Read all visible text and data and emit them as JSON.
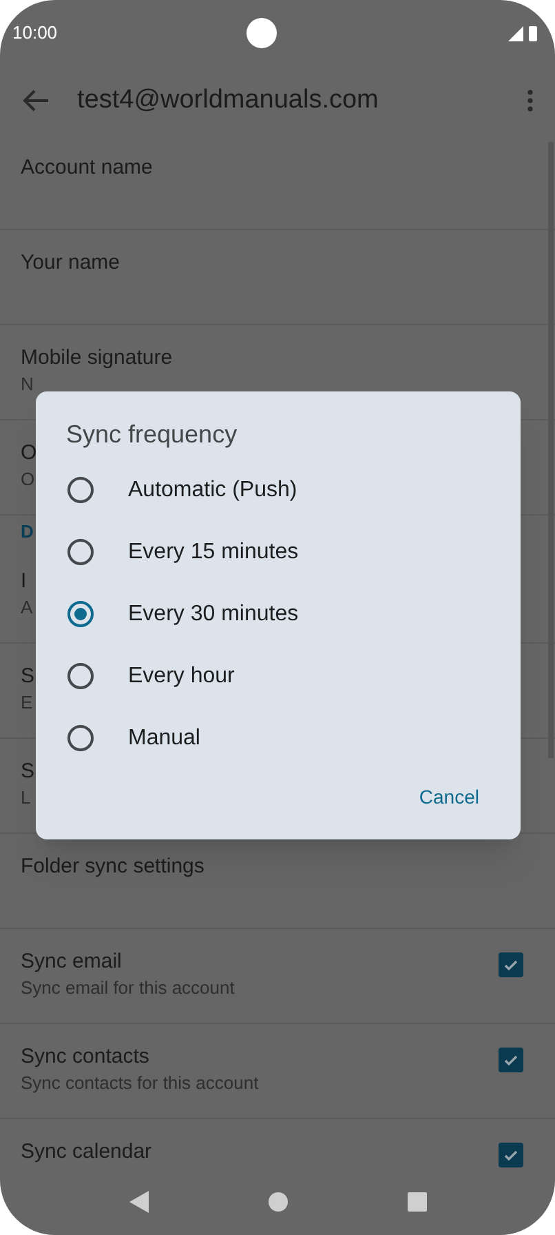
{
  "status_bar": {
    "time": "10:00"
  },
  "app_bar": {
    "title": "test4@worldmanuals.com"
  },
  "settings": [
    {
      "kind": "item",
      "title": "Account name"
    },
    {
      "kind": "item",
      "title": "Your name"
    },
    {
      "kind": "item",
      "title": "Mobile signature",
      "subtitle": "N"
    },
    {
      "kind": "item",
      "title": "O",
      "subtitle": "O"
    },
    {
      "kind": "header",
      "title": "D"
    },
    {
      "kind": "item",
      "title": "I",
      "subtitle": "A"
    },
    {
      "kind": "item",
      "title": "S",
      "subtitle": "E"
    },
    {
      "kind": "item",
      "title": "S",
      "subtitle": "L"
    },
    {
      "kind": "item",
      "title": "Folder sync settings"
    },
    {
      "kind": "check",
      "title": "Sync email",
      "subtitle": "Sync email for this account",
      "checked": true
    },
    {
      "kind": "check",
      "title": "Sync contacts",
      "subtitle": "Sync contacts for this account",
      "checked": true
    },
    {
      "kind": "check",
      "title": "Sync calendar",
      "checked": true
    }
  ],
  "dialog": {
    "title": "Sync frequency",
    "options": [
      {
        "label": "Automatic (Push)",
        "selected": false
      },
      {
        "label": "Every 15 minutes",
        "selected": false
      },
      {
        "label": "Every 30 minutes",
        "selected": true
      },
      {
        "label": "Every hour",
        "selected": false
      },
      {
        "label": "Manual",
        "selected": false
      }
    ],
    "buttons": [
      "Cancel"
    ]
  }
}
